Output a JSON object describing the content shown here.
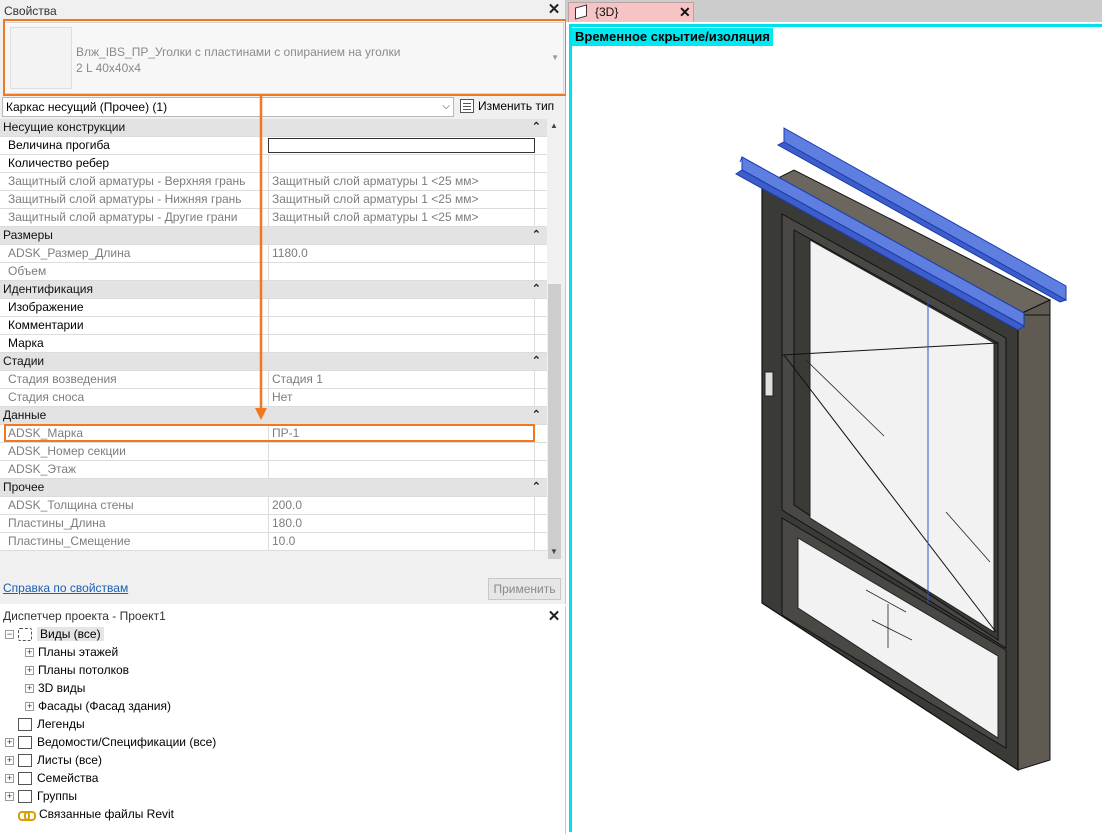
{
  "properties": {
    "title": "Свойства",
    "type_name": "Влж_IBS_ПР_Уголки с пластинами с опиранием на уголки",
    "type_size": "2 L 40x40x4",
    "instance_filter": "Каркас несущий (Прочее) (1)",
    "edit_type_label": "Изменить тип",
    "help_link": "Справка по свойствам",
    "apply_label": "Применить",
    "rows": [
      {
        "kind": "group",
        "name": "Несущие конструкции",
        "value": ""
      },
      {
        "kind": "en",
        "name": "Величина прогиба",
        "value": ""
      },
      {
        "kind": "en",
        "name": "Количество ребер",
        "value": ""
      },
      {
        "kind": "dis",
        "name": "Защитный слой арматуры - Верхняя грань",
        "value": "Защитный слой арматуры 1 <25 мм>"
      },
      {
        "kind": "dis",
        "name": "Защитный слой арматуры - Нижняя грань",
        "value": "Защитный слой арматуры 1 <25 мм>"
      },
      {
        "kind": "dis",
        "name": "Защитный слой арматуры - Другие грани",
        "value": "Защитный слой арматуры 1 <25 мм>"
      },
      {
        "kind": "group",
        "name": "Размеры",
        "value": ""
      },
      {
        "kind": "dis",
        "name": "ADSK_Размер_Длина",
        "value": "1180.0"
      },
      {
        "kind": "dis",
        "name": "Объем",
        "value": ""
      },
      {
        "kind": "group",
        "name": "Идентификация",
        "value": ""
      },
      {
        "kind": "en",
        "name": "Изображение",
        "value": ""
      },
      {
        "kind": "en",
        "name": "Комментарии",
        "value": ""
      },
      {
        "kind": "en",
        "name": "Марка",
        "value": ""
      },
      {
        "kind": "group",
        "name": "Стадии",
        "value": ""
      },
      {
        "kind": "dis",
        "name": "Стадия возведения",
        "value": "Стадия 1"
      },
      {
        "kind": "dis",
        "name": "Стадия сноса",
        "value": "Нет"
      },
      {
        "kind": "group",
        "name": "Данные",
        "value": ""
      },
      {
        "kind": "dis",
        "name": "ADSK_Марка",
        "value": "ПР-1"
      },
      {
        "kind": "dis",
        "name": "ADSK_Номер секции",
        "value": ""
      },
      {
        "kind": "dis",
        "name": "ADSK_Этаж",
        "value": ""
      },
      {
        "kind": "group",
        "name": "Прочее",
        "value": ""
      },
      {
        "kind": "dis",
        "name": "ADSK_Толщина стены",
        "value": "200.0"
      },
      {
        "kind": "dis",
        "name": "Пластины_Длина",
        "value": "180.0"
      },
      {
        "kind": "dis",
        "name": "Пластины_Смещение",
        "value": "10.0"
      }
    ]
  },
  "browser": {
    "title": "Диспетчер проекта - Проект1",
    "views_root": "Виды (все)",
    "items": [
      {
        "label": "Планы этажей"
      },
      {
        "label": "Планы потолков"
      },
      {
        "label": "3D виды"
      },
      {
        "label": "Фасады (Фасад здания)"
      }
    ],
    "roots": [
      {
        "label": "Легенды"
      },
      {
        "label": "Ведомости/Спецификации (все)"
      },
      {
        "label": "Листы (все)"
      },
      {
        "label": "Семейства"
      },
      {
        "label": "Группы"
      },
      {
        "label": "Связанные файлы Revit"
      }
    ]
  },
  "view": {
    "tab_label": "{3D}",
    "isolate_label": "Временное скрытие/изоляция"
  },
  "colors": {
    "highlight": "#f07820",
    "isolation_frame": "#00e0e8",
    "angle_blue": "#3060d8"
  }
}
